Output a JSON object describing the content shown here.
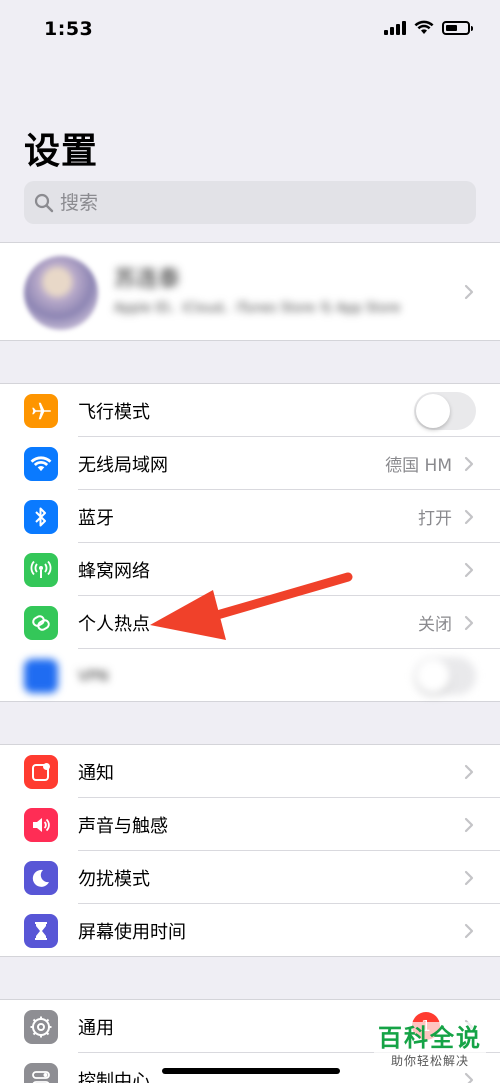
{
  "status": {
    "time": "1:53"
  },
  "title": "设置",
  "search": {
    "placeholder": "搜索"
  },
  "profile": {
    "name": "苏连泰",
    "subtitle": "Apple ID、iCloud、iTunes Store 与 App Store"
  },
  "group1": [
    {
      "id": "airplane",
      "label": "飞行模式",
      "icon": "airplane-icon",
      "color": "#fe9500",
      "control": "toggle",
      "toggle_on": false
    },
    {
      "id": "wifi",
      "label": "无线局域网",
      "icon": "wifi-icon",
      "color": "#0a7aff",
      "value": "德国 HM"
    },
    {
      "id": "bluetooth",
      "label": "蓝牙",
      "icon": "bluetooth-icon",
      "color": "#0a7aff",
      "value": "打开"
    },
    {
      "id": "cellular",
      "label": "蜂窝网络",
      "icon": "antenna-icon",
      "color": "#34c759"
    },
    {
      "id": "hotspot",
      "label": "个人热点",
      "icon": "hotspot-link-icon",
      "color": "#34c759",
      "value": "关闭"
    },
    {
      "id": "vpn",
      "label": "VPN",
      "icon": "vpn-icon",
      "color": "#1f6cf1",
      "control": "toggle",
      "toggle_on": false,
      "blurred": true
    }
  ],
  "group2": [
    {
      "id": "notifications",
      "label": "通知",
      "icon": "notification-icon",
      "color": "#ff3b30"
    },
    {
      "id": "sounds",
      "label": "声音与触感",
      "icon": "speaker-icon",
      "color": "#ff2d55"
    },
    {
      "id": "dnd",
      "label": "勿扰模式",
      "icon": "moon-icon",
      "color": "#5856d6"
    },
    {
      "id": "screentime",
      "label": "屏幕使用时间",
      "icon": "hourglass-icon",
      "color": "#5856d6"
    }
  ],
  "group3": [
    {
      "id": "general",
      "label": "通用",
      "icon": "gear-icon",
      "color": "#8e8e93",
      "badge": "1"
    },
    {
      "id": "control",
      "label": "控制中心",
      "icon": "toggles-icon",
      "color": "#8e8e93"
    }
  ],
  "watermark": {
    "title": "百科全说",
    "subtitle": "助你轻松解决"
  },
  "colors": {
    "background": "#efeef4",
    "annotation_arrow": "#f0412a"
  }
}
